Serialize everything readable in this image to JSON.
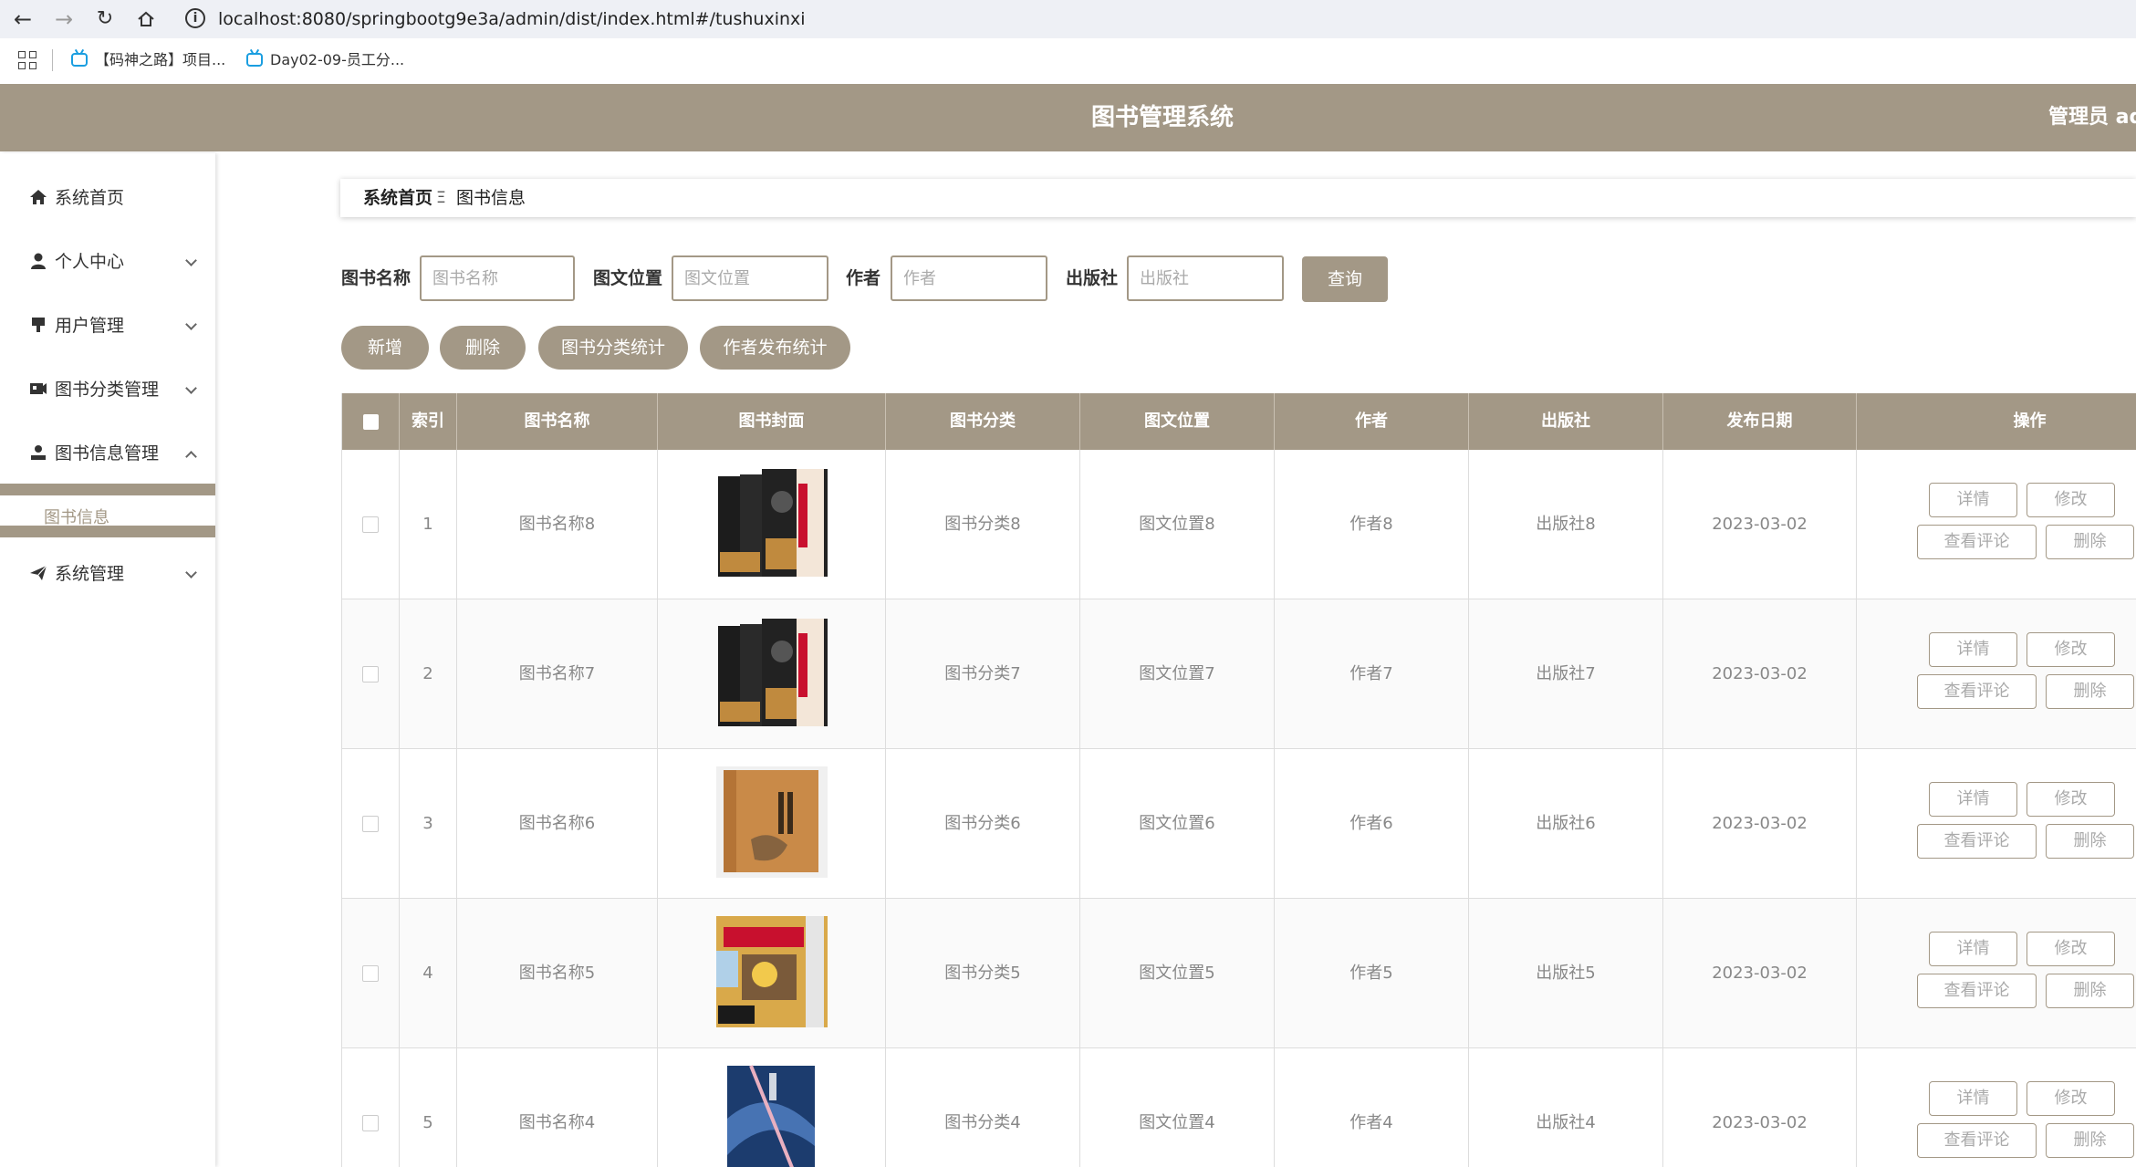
{
  "browser": {
    "url": "localhost:8080/springbootg9e3a/admin/dist/index.html#/tushuxinxi",
    "bookmarks": [
      "【码神之路】项目...",
      "Day02-09-员工分..."
    ]
  },
  "header": {
    "title": "图书管理系统",
    "user": "管理员 adı"
  },
  "sidebar": {
    "items": [
      {
        "label": "系统首页",
        "icon": "home-icon"
      },
      {
        "label": "个人中心",
        "icon": "user-icon"
      },
      {
        "label": "用户管理",
        "icon": "user-manage-icon"
      },
      {
        "label": "图书分类管理",
        "icon": "category-icon"
      },
      {
        "label": "图书信息管理",
        "icon": "book-user-icon"
      },
      {
        "label": "系统管理",
        "icon": "send-icon"
      }
    ],
    "sub_item": "图书信息"
  },
  "breadcrumb": {
    "home": "系统首页",
    "separator": "Ξ",
    "current": "图书信息"
  },
  "search": {
    "fields": [
      {
        "label": "图书名称",
        "placeholder": "图书名称"
      },
      {
        "label": "图文位置",
        "placeholder": "图文位置"
      },
      {
        "label": "作者",
        "placeholder": "作者"
      },
      {
        "label": "出版社",
        "placeholder": "出版社"
      }
    ],
    "query_label": "查询"
  },
  "actions": {
    "add": "新增",
    "delete": "删除",
    "category_stats": "图书分类统计",
    "author_stats": "作者发布统计"
  },
  "table": {
    "columns": [
      "索引",
      "图书名称",
      "图书封面",
      "图书分类",
      "图文位置",
      "作者",
      "出版社",
      "发布日期",
      "操作"
    ],
    "row_actions": {
      "detail": "详情",
      "edit": "修改",
      "comments": "查看评论",
      "delete": "删除"
    },
    "rows": [
      {
        "index": "1",
        "name": "图书名称8",
        "category": "图书分类8",
        "position": "图文位置8",
        "author": "作者8",
        "publisher": "出版社8",
        "date": "2023-03-02",
        "cover": "dark-box"
      },
      {
        "index": "2",
        "name": "图书名称7",
        "category": "图书分类7",
        "position": "图文位置7",
        "author": "作者7",
        "publisher": "出版社7",
        "date": "2023-03-02",
        "cover": "dark-box"
      },
      {
        "index": "3",
        "name": "图书名称6",
        "category": "图书分类6",
        "position": "图文位置6",
        "author": "作者6",
        "publisher": "出版社6",
        "date": "2023-03-02",
        "cover": "tan-book"
      },
      {
        "index": "4",
        "name": "图书名称5",
        "category": "图书分类5",
        "position": "图文位置5",
        "author": "作者5",
        "publisher": "出版社5",
        "date": "2023-03-02",
        "cover": "comic"
      },
      {
        "index": "5",
        "name": "图书名称4",
        "category": "图书分类4",
        "position": "图文位置4",
        "author": "作者4",
        "publisher": "出版社4",
        "date": "2023-03-02",
        "cover": "blue-book"
      }
    ]
  },
  "colors": {
    "accent": "#a39886",
    "header_text": "#ffffff",
    "muted_text": "#888888"
  }
}
